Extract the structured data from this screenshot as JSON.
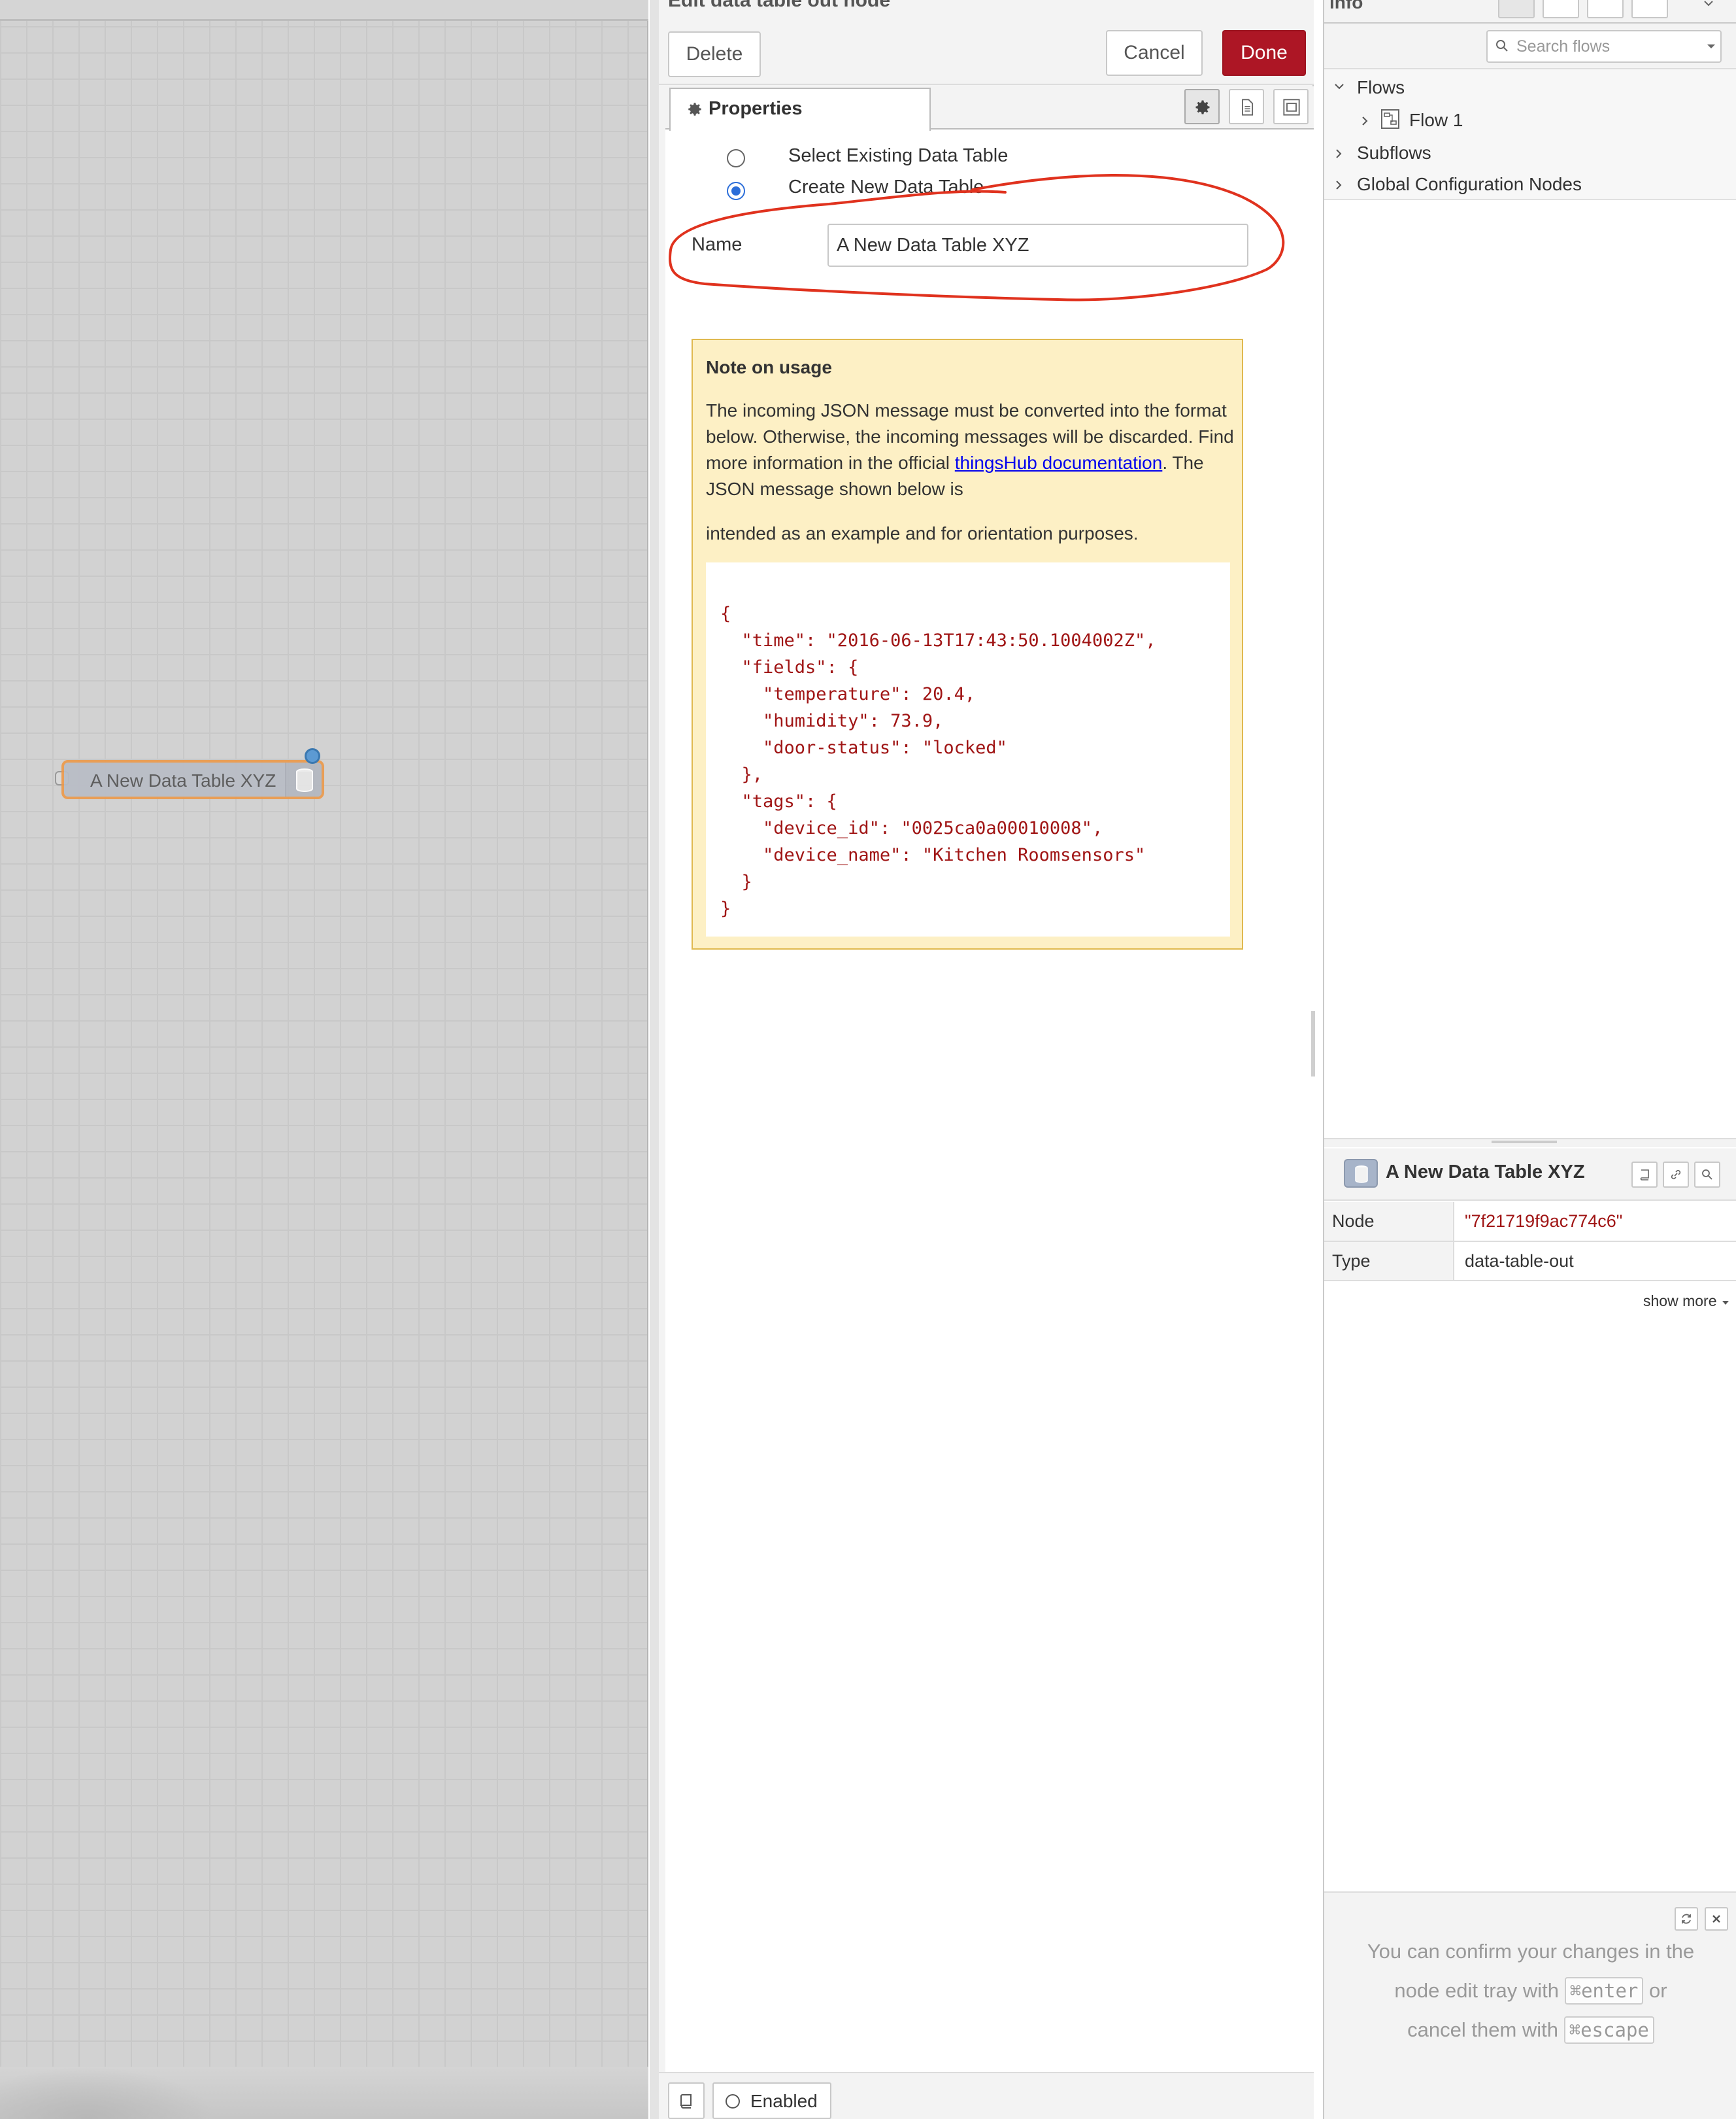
{
  "canvas": {
    "node_label": "A New Data Table XYZ"
  },
  "tray": {
    "title": "Edit data table out node",
    "delete_label": "Delete",
    "cancel_label": "Cancel",
    "done_label": "Done",
    "tabs": {
      "properties": "Properties"
    },
    "radio_existing": "Select Existing Data Table",
    "radio_new": "Create New Data Table",
    "selected_option": "Create New Data Table",
    "name_label": "Name",
    "name_value": "A New Data Table XYZ",
    "note": {
      "title": "Note on usage",
      "text_1": "The incoming JSON message must be converted into the format below. Otherwise, the incoming messages will be discarded. Find more information in the official ",
      "link": "thingsHub documentation",
      "text_2": ". The JSON message shown below is",
      "text_3": "intended as an example and for orientation purposes.",
      "json_example": "{\n  \"time\": \"2016-06-13T17:43:50.1004002Z\",\n  \"fields\": {\n    \"temperature\": 20.4,\n    \"humidity\": 73.9,\n    \"door-status\": \"locked\"\n  },\n  \"tags\": {\n    \"device_id\": \"0025ca0a00010008\",\n    \"device_name\": \"Kitchen Roomsensors\"\n  }\n}"
    },
    "footer": {
      "enabled_label": "Enabled"
    },
    "annotation_color": "#e0321e"
  },
  "sidebar": {
    "tab_label": "info",
    "search_placeholder": "Search flows",
    "tree": {
      "flows": "Flows",
      "flow_1": "Flow 1",
      "subflows": "Subflows",
      "global_config": "Global Configuration Nodes"
    },
    "node_info": {
      "title": "A New Data Table XYZ",
      "node_key": "Node",
      "node_value": "\"7f21719f9ac774c6\"",
      "type_key": "Type",
      "type_value": "data-table-out",
      "show_more": "show more"
    },
    "help": {
      "line_1": "You can confirm your changes in the",
      "line_2a": "node edit tray with",
      "key_enter": "⌘enter",
      "line_2b": "or",
      "line_3a": "cancel them with",
      "key_escape": "⌘escape"
    }
  },
  "colors": {
    "done_button": "#ad1625",
    "node_selected_border": "#ec9a4c",
    "radio_selected": "#2c6ed9",
    "json_text": "#a01515",
    "note_bg": "#fdf0c5"
  }
}
